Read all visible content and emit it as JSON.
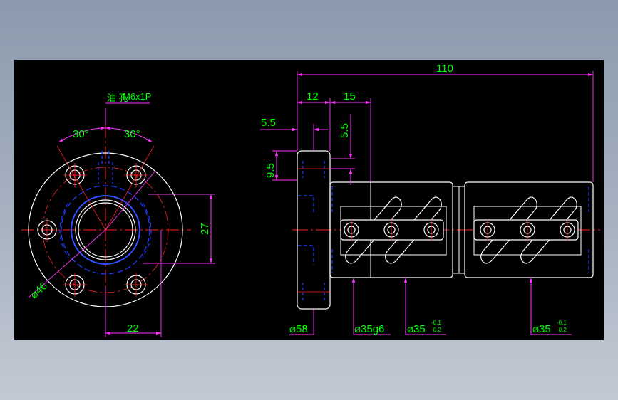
{
  "colors": {
    "background": "#000000",
    "outline": "#ffffff",
    "centerline": "#ff2020",
    "hidden": "#1e3cff",
    "dimension_line": "#ff33ff",
    "dimension_text": "#00ff00",
    "thread": "#3050ff"
  },
  "front_view": {
    "oil_hole_label": "油 孔",
    "thread_label": "M6x1P",
    "angle_left": "30°",
    "angle_right": "30°",
    "dim_bolt_circle": "⌀46",
    "dim_height": "27",
    "dim_width": "22"
  },
  "side_view": {
    "dim_total_length": "110",
    "dim_flange": "12",
    "dim_offset": "15",
    "dim_small_left": "5.5",
    "dim_small_vertical": "5.5",
    "dim_hole_pitch": "9.5",
    "dia_flange": "⌀58",
    "dia_body": "⌀35g6",
    "dia_recess_1": "⌀35",
    "dia_recess_2": "⌀35",
    "tol_upper": "-0.1",
    "tol_lower": "-0.2"
  }
}
